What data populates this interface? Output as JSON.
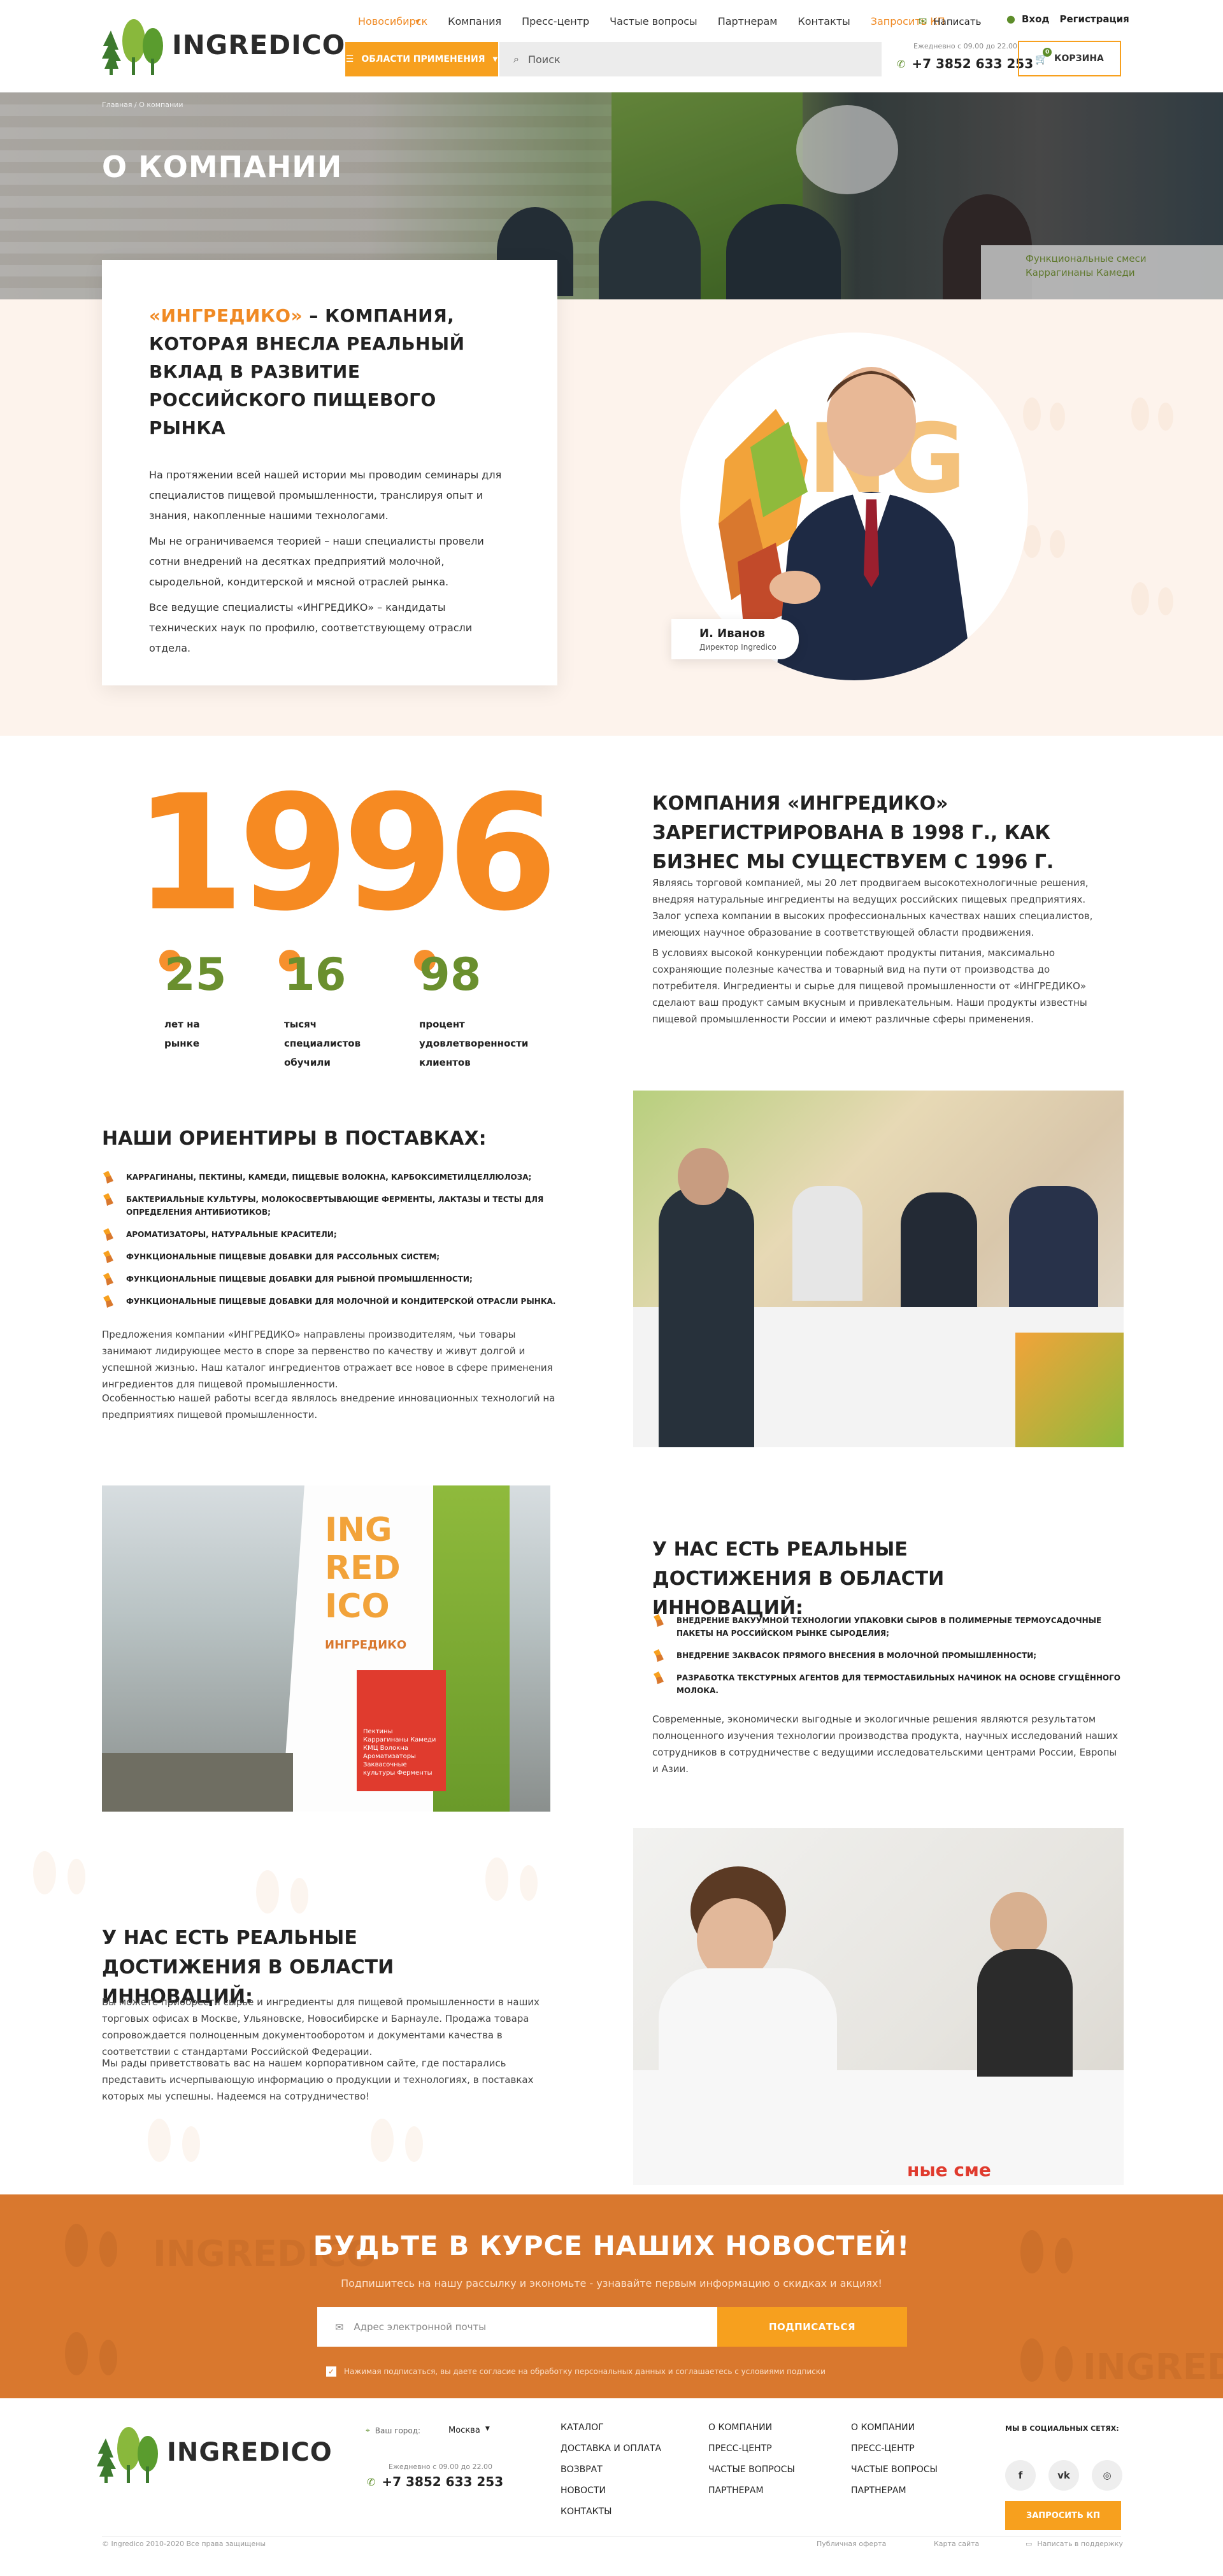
{
  "brand": {
    "name": "INGREDICO"
  },
  "header": {
    "nav": [
      "Новосибирск",
      "Компания",
      "Пресс-центр",
      "Частые вопросы",
      "Партнерам",
      "Контакты",
      "Запросить КП"
    ],
    "write": "Написать",
    "login": "Вход",
    "register": "Регистрация",
    "hours": "Ежедневно с 09.00 до 22.00",
    "phone": "+7 3852 633 253",
    "areas_btn": "ОБЛАСТИ ПРИМЕНЕНИЯ",
    "search_placeholder": "Поиск",
    "cart_label": "КОРЗИНА",
    "cart_count": "0"
  },
  "hero": {
    "breadcrumb": "Главная  /  О компании",
    "title": "О КОМПАНИИ",
    "booth_text": "Функциональные смеси  Каррагинаны  Камеди"
  },
  "about": {
    "heading_accent": "«ИНГРЕДИКО»",
    "heading_rest": " – КОМПАНИЯ, КОТОРАЯ ВНЕСЛА РЕАЛЬНЫЙ ВКЛАД В РАЗВИТИЕ РОССИЙСКОГО ПИЩЕВОГО РЫНКА",
    "paragraphs": [
      "На протяжении всей нашей истории мы проводим семинары для специалистов пищевой промышленности, транслируя опыт и знания, накопленные нашими технологами.",
      "Мы не ограничиваемся теорией – наши специалисты провели сотни внедрений на десятках предприятий молочной, сыродельной, кондитерской и мясной отраслей рынка.",
      "Все ведущие специалисты «ИНГРЕДИКО» – кандидаты технических наук по профилю, соответствующему отрасли отдела."
    ],
    "person_name": "И. Иванов",
    "person_role": "Директор Ingredico"
  },
  "history": {
    "year": "1996",
    "stats": [
      {
        "value": "25",
        "label": "лет на рынке"
      },
      {
        "value": "16",
        "label": "тысяч специалистов обучили"
      },
      {
        "value": "98",
        "label": "процент удовлетворенности клиентов"
      }
    ],
    "heading": "КОМПАНИЯ «ИНГРЕДИКО» ЗАРЕГИСТРИРОВАНА В 1998 Г., КАК БИЗНЕС МЫ СУЩЕСТВУЕМ С 1996 Г.",
    "paragraphs": [
      "Являясь торговой компанией, мы 20 лет продвигаем высокотехнологичные решения, внедряя натуральные ингредиенты на ведущих российских пищевых предприятиях. Залог успеха компании в высоких профессиональных качествах наших специалистов, имеющих научное образование в соответствующей области продвижения.",
      "В условиях высокой конкуренции побеждают продукты питания, максимально сохраняющие полезные качества и товарный вид на пути от производства до потребителя. Ингредиенты и сырье для пищевой промышленности от «ИНГРЕДИКО» сделают ваш продукт самым вкусным и привлекательным. Наши продукты известны пищевой промышленности России и имеют различные сферы применения."
    ]
  },
  "supplies": {
    "heading": "НАШИ ОРИЕНТИРЫ В ПОСТАВКАХ:",
    "items": [
      "КАРРАГИНАНЫ, ПЕКТИНЫ, КАМЕДИ, ПИЩЕВЫЕ ВОЛОКНА, КАРБОКСИМЕТИЛЦЕЛЛЮЛОЗА;",
      "БАКТЕРИАЛЬНЫЕ КУЛЬТУРЫ, МОЛОКОСВЕРТЫВАЮЩИЕ ФЕРМЕНТЫ, ЛАКТАЗЫ И ТЕСТЫ ДЛЯ ОПРЕДЕЛЕНИЯ АНТИБИОТИКОВ;",
      "АРОМАТИЗАТОРЫ, НАТУРАЛЬНЫЕ КРАСИТЕЛИ;",
      "ФУНКЦИОНАЛЬНЫЕ ПИЩЕВЫЕ ДОБАВКИ ДЛЯ РАССОЛЬНЫХ СИСТЕМ;",
      "ФУНКЦИОНАЛЬНЫЕ ПИЩЕВЫЕ ДОБАВКИ ДЛЯ РЫБНОЙ ПРОМЫШЛЕННОСТИ;",
      "ФУНКЦИОНАЛЬНЫЕ ПИЩЕВЫЕ ДОБАВКИ ДЛЯ МОЛОЧНОЙ И КОНДИТЕРСКОЙ ОТРАСЛИ РЫНКА."
    ],
    "paragraphs": [
      "Предложения компании «ИНГРЕДИКО» направлены производителям, чьи товары занимают лидирующее место в споре за первенство по качеству и живут долгой и успешной жизнью. Наш каталог ингредиентов отражает все новое в сфере применения ингредиентов для пищевой промышленности.",
      "Особенностью нашей работы всегда являлось внедрение инновационных технологий на предприятиях пищевой промышленности."
    ]
  },
  "innovations": {
    "heading": "У НАС ЕСТЬ РЕАЛЬНЫЕ ДОСТИЖЕНИЯ В ОБЛАСТИ ИННОВАЦИЙ:",
    "items": [
      "ВНЕДРЕНИЕ ВАКУУМНОЙ ТЕХНОЛОГИИ УПАКОВКИ СЫРОВ В ПОЛИМЕРНЫЕ ТЕРМОУСАДОЧНЫЕ ПАКЕТЫ НА РОССИЙСКОМ РЫНКЕ СЫРОДЕЛИЯ;",
      "ВНЕДРЕНИЕ ЗАКВАСОК ПРЯМОГО ВНЕСЕНИЯ В МОЛОЧНОЙ ПРОМЫШЛЕННОСТИ;",
      "РАЗРАБОТКА ТЕКСТУРНЫХ АГЕНТОВ ДЛЯ ТЕРМОСТАБИЛЬНЫХ НАЧИНОК НА ОСНОВЕ СГУЩЁННОГО МОЛОКА."
    ],
    "paragraph": "Современные, экономически выгодные и экологичные решения являются результатом полноценного изучения технологии производства продукта, научных исследований наших сотрудников в сотрудничестве с ведущими исследовательскими центрами России, Европы и Азии.",
    "stand_title": "ИНГРЕДИКО",
    "stand_sub": "Пектины Каррагинаны Камеди КМЦ Волокна Ароматизаторы Заквасочные культуры Ферменты"
  },
  "innovations2": {
    "heading": "У НАС ЕСТЬ РЕАЛЬНЫЕ ДОСТИЖЕНИЯ В ОБЛАСТИ ИННОВАЦИЙ:",
    "paragraphs": [
      "Вы можете приобрести сырье и ингредиенты для пищевой промышленности в наших торговых офисах в Москве, Ульяновске, Новосибирске и Барнауле. Продажа товара сопровождается полноценным документооборотом и документами качества в соответствии с стандартами Российской Федерации.",
      "Мы рады приветствовать вас на нашем корпоративном сайте, где постарались представить исчерпывающую информацию о продукции и технологиях, в поставках которых мы успешны. Надеемся на сотрудничество!"
    ]
  },
  "newsletter": {
    "title": "БУДЬТЕ В КУРСЕ НАШИХ НОВОСТЕЙ!",
    "subtitle": "Подпишитесь на нашу рассылку и экономьте - узнавайте первым информацию о скидках и акциях!",
    "email_placeholder": "Адрес электронной почты",
    "button": "ПОДПИСАТЬСЯ",
    "agree": "Нажимая подписаться, вы даете согласие на обработку персональных данных и соглашаетесь c условиями подписки"
  },
  "footer": {
    "city_label": "Ваш город:",
    "city_value": "Москва",
    "hours": "Ежедневно с 09.00 до 22.00",
    "phone": "+7 3852 633 253",
    "col1": [
      "КАТАЛОГ",
      "ДОСТАВКА И ОПЛАТА",
      "ВОЗВРАТ",
      "НОВОСТИ",
      "КОНТАКТЫ"
    ],
    "col2": [
      "О КОМПАНИИ",
      "ПРЕСС-ЦЕНТР",
      "ЧАСТЫЕ ВОПРОСЫ",
      "ПАРТНЕРАМ"
    ],
    "col3": [
      "О КОМПАНИИ",
      "ПРЕСС-ЦЕНТР",
      "ЧАСТЫЕ ВОПРОСЫ",
      "ПАРТНЕРАМ"
    ],
    "social_title": "МЫ В СОЦИАЛЬНЫХ СЕТЯХ:",
    "social": [
      "f",
      "vk",
      "ig"
    ],
    "kp_button": "ЗАПРОСИТЬ КП",
    "copyright": "© Ingredico 2010-2020 Все права защищены",
    "offer": "Публичная оферта",
    "sitemap": "Карта сайта",
    "support": "Написать в поддержку"
  },
  "colors": {
    "accent": "#f7a01e",
    "orange_deep": "#d9782e",
    "green": "#5d8d2a",
    "peach_bg": "#fdf3ec"
  }
}
